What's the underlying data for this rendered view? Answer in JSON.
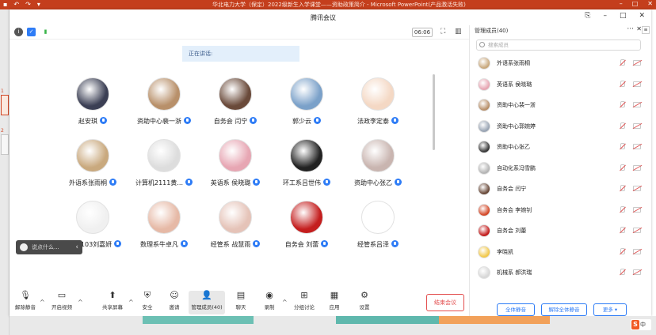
{
  "ppt": {
    "title": "华北电力大学（保定）2022级新生入学课堂——资助政策简介  -  Microsoft PowerPoint(产品激活失败)",
    "slide_numbers": [
      "1",
      "2"
    ],
    "colors": {
      "bar": "#c43e1c",
      "accent": "#d24726"
    }
  },
  "meeting": {
    "window_title": "腾讯会议",
    "timer": "06:06",
    "speaking_label": "正在讲话:",
    "participants": [
      {
        "name": "赵安琪",
        "color": "#3b3f54"
      },
      {
        "name": "资助中心裴一浙",
        "color": "#b8906a"
      },
      {
        "name": "自务会  闫宁",
        "color": "#6a4a3a"
      },
      {
        "name": "郭少云",
        "color": "#7ba1c9"
      },
      {
        "name": "法政李定泰",
        "color": "#f4d8c4"
      },
      {
        "name": "外语系张雨桐",
        "color": "#c9a97e"
      },
      {
        "name": "计算机2111黄...",
        "color": "#dddddd"
      },
      {
        "name": "英语系  侯晓璐",
        "color": "#e7a6b3"
      },
      {
        "name": "环工系吕世伟",
        "color": "#222222"
      },
      {
        "name": "资助中心张乙",
        "color": "#c9b5b0"
      },
      {
        "name": "电信2103刘嘉妍",
        "color": "#f0f0f0"
      },
      {
        "name": "数理系牛卓凡",
        "color": "#e6b9a6"
      },
      {
        "name": "经管系  战慧雨",
        "color": "#e5c3b8"
      },
      {
        "name": "自务会  刘蕾",
        "color": "#c41e1e"
      },
      {
        "name": "经管系吕泽",
        "color": "#ffffff"
      }
    ],
    "caption_text": "说点什么...",
    "toolbar": {
      "unmute": "解除静音",
      "start_video": "开启视频",
      "share": "共享屏幕",
      "security": "安全",
      "invite": "邀请",
      "members": "管理成员(40)",
      "chat": "聊天",
      "record": "录制",
      "breakout": "分组讨论",
      "apps": "应用",
      "settings": "设置",
      "end": "结束会议"
    },
    "panel": {
      "header": "管理成员(40)",
      "more": "···",
      "search_placeholder": "搜索成员",
      "members": [
        {
          "name": "外语系张雨桐",
          "color": "#c9a97e"
        },
        {
          "name": "英语系  侯晓璐",
          "color": "#e7a6b3"
        },
        {
          "name": "资助中心裴一浙",
          "color": "#b8906a"
        },
        {
          "name": "资助中心郭婉婷",
          "color": "#9aa5b4"
        },
        {
          "name": "资助中心张乙",
          "color": "#3a3a3a"
        },
        {
          "name": "自动化系冯雪鹏",
          "color": "#b5b5b5"
        },
        {
          "name": "自务会  闫宁",
          "color": "#6a4a3a"
        },
        {
          "name": "自务会 李婉钊",
          "color": "#d44a2a"
        },
        {
          "name": "自务会 刘蕾",
          "color": "#c41e1e"
        },
        {
          "name": "李晓凯",
          "color": "#f2c94c"
        },
        {
          "name": "机械系  郝洪瑞",
          "color": "#d8d8d8"
        }
      ],
      "mute_all": "全体静音",
      "unmute_all": "解除全体静音",
      "more_btn": "更多 ▾"
    }
  },
  "ime": {
    "label": "中"
  }
}
